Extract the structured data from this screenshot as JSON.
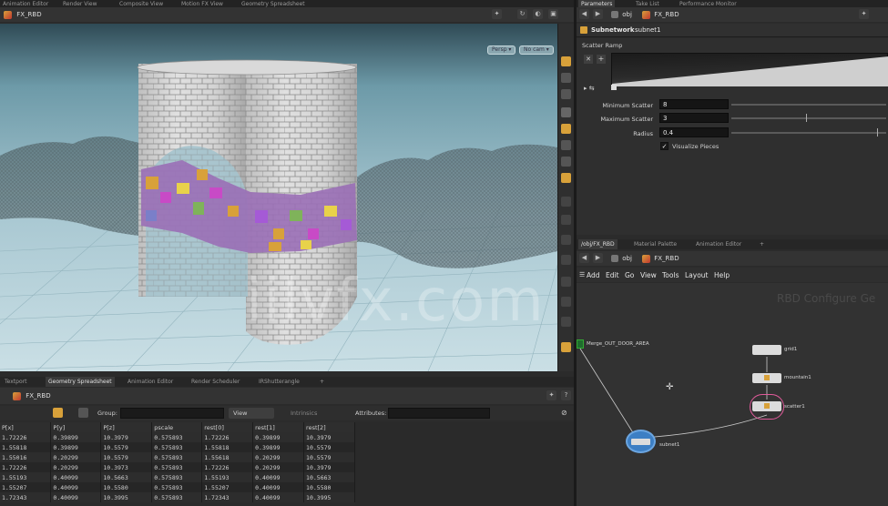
{
  "top_tabs": [
    "Animation Editor",
    "Render View",
    "Composite View",
    "Motion FX View",
    "Geometry Spreadsheet"
  ],
  "viewport": {
    "network_path": "FX_RBD",
    "persp_label": "Persp",
    "cam_label": "No cam"
  },
  "param_panel": {
    "top_tabs": [
      "Parameters",
      "Take List",
      "Performance Monitor"
    ],
    "path_obj": "obj",
    "path_network": "FX_RBD",
    "node_type": "Subnetwork",
    "node_name": "subnet1",
    "scatter_ramp_label": "Scatter Ramp",
    "params": [
      {
        "label": "Minimum Scatter",
        "value": "8"
      },
      {
        "label": "Maximum Scatter",
        "value": "3"
      },
      {
        "label": "Radius",
        "value": "0.4"
      }
    ],
    "visualize_label": "Visualize Pieces",
    "visualize_checked": true
  },
  "network_editor": {
    "tabs": [
      "/obj/FX_RBD",
      "Material Palette",
      "Animation Editor"
    ],
    "path_obj": "obj",
    "path_network": "FX_RBD",
    "menu": [
      "Add",
      "Edit",
      "Go",
      "View",
      "Tools",
      "Layout",
      "Help"
    ],
    "watermark_text": "RBD Configure Ge",
    "nodes": {
      "merge": "Merge_OUT_DOOR_AREA",
      "grid": "grid1",
      "mountain": "mountain1",
      "scatter": "scatter1",
      "subnet": "subnet1"
    }
  },
  "spreadsheet": {
    "tabs": [
      "Textport",
      "Geometry Spreadsheet",
      "Animation Editor",
      "Render Scheduler",
      "IRShutterangle"
    ],
    "path_network": "FX_RBD",
    "group_label": "Group:",
    "view_label": "View",
    "intrinsics_label": "Intrinsics",
    "attributes_label": "Attributes:",
    "columns": [
      "P[x]",
      "P[y]",
      "P[z]",
      "pscale",
      "rest[0]",
      "rest[1]",
      "rest[2]"
    ],
    "rows": [
      [
        "1.72226",
        "0.39899",
        "10.3979",
        "0.575893",
        "1.72226",
        "0.39899",
        "10.3979"
      ],
      [
        "1.55818",
        "0.39899",
        "10.5579",
        "0.575893",
        "1.55818",
        "0.39899",
        "10.5579"
      ],
      [
        "1.55016",
        "0.20299",
        "10.5579",
        "0.575893",
        "1.55618",
        "0.20299",
        "10.5579"
      ],
      [
        "1.72226",
        "0.20299",
        "10.3973",
        "0.575893",
        "1.72226",
        "0.20299",
        "10.3979"
      ],
      [
        "1.55193",
        "0.40099",
        "10.5663",
        "0.575893",
        "1.55193",
        "0.40099",
        "10.5663"
      ],
      [
        "1.55207",
        "0.40099",
        "10.5580",
        "0.575893",
        "1.55207",
        "0.40099",
        "10.5580"
      ],
      [
        "1.72343",
        "0.40099",
        "10.3995",
        "0.575893",
        "1.72343",
        "0.40099",
        "10.3995"
      ]
    ]
  },
  "watermark": "iilvfx.com",
  "colors": {
    "accent_orange": "#d8a13a",
    "node_selected": "#e05a9a",
    "subnet_blue": "#3d7fc4",
    "viewport_sky": "#aacbd6"
  }
}
